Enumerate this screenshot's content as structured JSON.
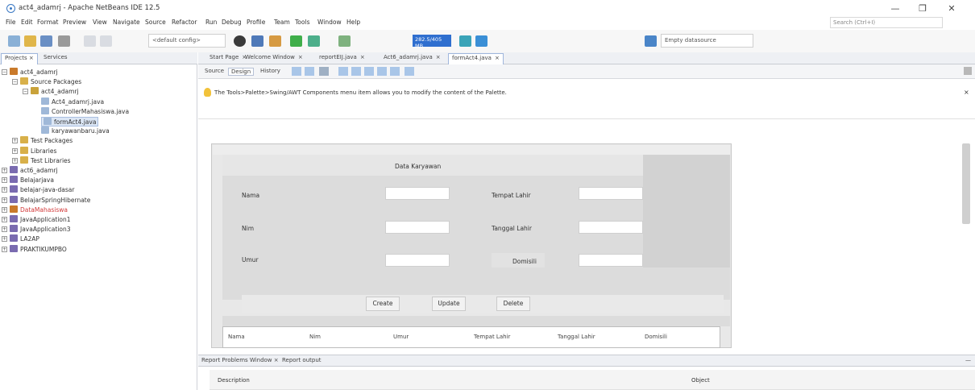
{
  "window": {
    "title": "act4_adamrj - Apache NetBeans IDE 12.5",
    "minimize": "—",
    "maximize": "❐",
    "close": "✕"
  },
  "menu": [
    "File",
    "Edit",
    "Format",
    "Preview",
    "View",
    "Navigate",
    "Source",
    "Refactor",
    "Run",
    "Debug",
    "Profile",
    "Team",
    "Tools",
    "Window",
    "Help"
  ],
  "search": {
    "placeholder": "Search (Ctrl+I)"
  },
  "toolbar": {
    "config": "<default config>",
    "coords": "282.5/405 MB",
    "datasource": "Empty datasource"
  },
  "left_tabs": {
    "projects": "Projects",
    "services": "Services",
    "close_mark": "×"
  },
  "tree": [
    {
      "label": "act4_adamrj",
      "indent": 0,
      "icon": "#c97a2b"
    },
    {
      "label": "Source Packages",
      "indent": 1,
      "icon": "#d8b04a"
    },
    {
      "label": "act4_adamrj",
      "indent": 2,
      "icon": "#c9a23a"
    },
    {
      "label": "Act4_adamrj.java",
      "indent": 3,
      "icon": "#9fb8d8"
    },
    {
      "label": "ControllerMahasiswa.java",
      "indent": 3,
      "icon": "#9fb8d8"
    },
    {
      "label": "formAct4.java",
      "indent": 3,
      "icon": "#9fb8d8",
      "selected": true
    },
    {
      "label": "karyawanbaru.java",
      "indent": 3,
      "icon": "#9fb8d8"
    },
    {
      "label": "Test Packages",
      "indent": 1,
      "icon": "#d8b04a"
    },
    {
      "label": "Libraries",
      "indent": 1,
      "icon": "#d8b04a"
    },
    {
      "label": "Test Libraries",
      "indent": 1,
      "icon": "#d8b04a"
    },
    {
      "label": "act6_adamrj",
      "indent": 0,
      "icon": "#7a6bb0"
    },
    {
      "label": "Belajarjava",
      "indent": 0,
      "icon": "#7a6bb0"
    },
    {
      "label": "belajar-java-dasar",
      "indent": 0,
      "icon": "#7a6bb0"
    },
    {
      "label": "BelajarSpringHibernate",
      "indent": 0,
      "icon": "#7a6bb0"
    },
    {
      "label": "DataMahasiswa",
      "indent": 0,
      "icon": "#c97a2b",
      "highlight": true
    },
    {
      "label": "JavaApplication1",
      "indent": 0,
      "icon": "#7a6bb0"
    },
    {
      "label": "JavaApplication3",
      "indent": 0,
      "icon": "#7a6bb0"
    },
    {
      "label": "LA2AP",
      "indent": 0,
      "icon": "#7a6bb0"
    },
    {
      "label": "PRAKTIKUMPBO",
      "indent": 0,
      "icon": "#7a6bb0"
    }
  ],
  "editor_tabs": [
    {
      "label": "Start Page",
      "active": false
    },
    {
      "label": "Welcome Window",
      "active": false
    },
    {
      "label": "reportEIJ.java",
      "active": false
    },
    {
      "label": "Act6_adamrj.java",
      "active": false
    },
    {
      "label": "formAct4.java",
      "active": true
    }
  ],
  "editor_tab_close": "×",
  "editor_toolbar": {
    "source": "Source",
    "design": "Design",
    "history": "History"
  },
  "info": "The Tools>Palette>Swing/AWT Components menu item allows you to modify the content of the Palette.",
  "form": {
    "title": "Data Karyawan",
    "labels": {
      "nama": "Nama",
      "nim": "Nim",
      "umur": "Umur",
      "tempat_lahir": "Tempat Lahir",
      "tanggal_lahir": "Tanggal Lahir",
      "domisili": "Domisili"
    },
    "buttons": {
      "create": "Create",
      "update": "Update",
      "delete": "Delete"
    },
    "table_headers": [
      "Nama",
      "Nim",
      "Umur",
      "Tempat Lahir",
      "Tanggal Lahir",
      "Domisili"
    ]
  },
  "bottom": {
    "tabs": [
      "Report Problems Window",
      "Report output"
    ],
    "col_description": "Description",
    "col_object": "Object"
  }
}
